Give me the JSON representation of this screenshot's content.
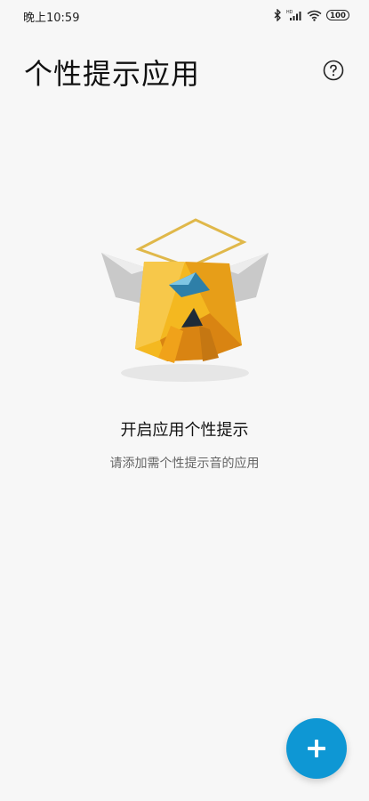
{
  "status_bar": {
    "time": "晚上10:59",
    "battery": "100",
    "icons": [
      "bluetooth-icon",
      "signal-icon",
      "wifi-icon",
      "battery-icon"
    ]
  },
  "header": {
    "title": "个性提示应用",
    "help_icon": "help-circle-icon"
  },
  "empty_state": {
    "illustration": "angel-mascot",
    "title": "开启应用个性提示",
    "subtitle": "请添加需个性提示音的应用"
  },
  "fab": {
    "icon": "plus-icon",
    "color": "#0e97d4"
  },
  "colors": {
    "background": "#f7f7f7",
    "accent": "#0e97d4"
  }
}
